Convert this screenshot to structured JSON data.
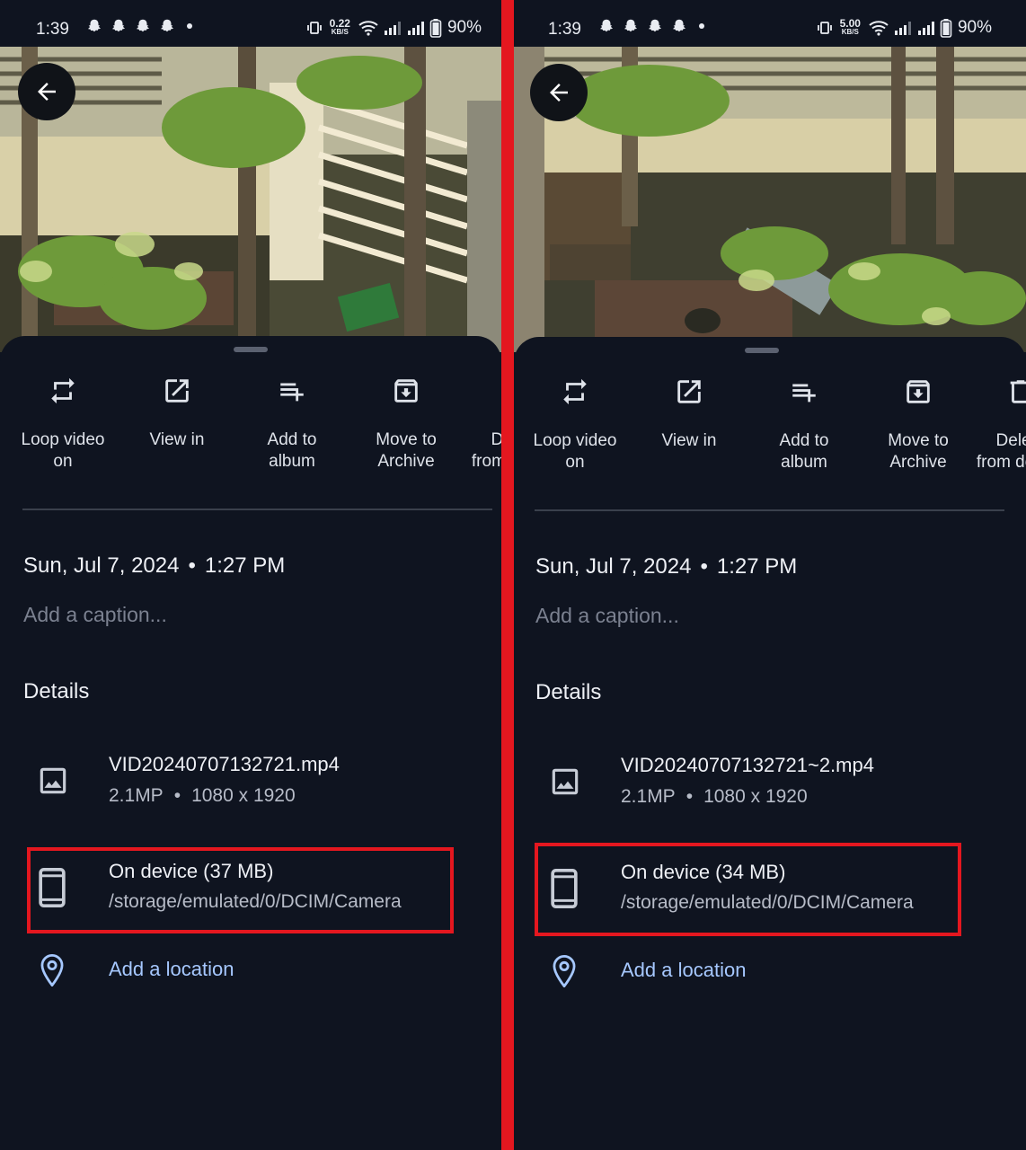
{
  "panels": [
    {
      "status": {
        "time": "1:39",
        "speed_value": "0.22",
        "speed_unit": "KB/S",
        "battery": "90%"
      },
      "actions": [
        {
          "label": "Loop video\non",
          "icon": "loop-icon"
        },
        {
          "label": "View in",
          "icon": "open-external-icon"
        },
        {
          "label": "Add to\nalbum",
          "icon": "playlist-add-icon"
        },
        {
          "label": "Move to\nArchive",
          "icon": "archive-icon"
        },
        {
          "label": "Delete\nfrom device",
          "icon": "delete-icon"
        }
      ],
      "date": "Sun, Jul 7, 2024",
      "time": "1:27 PM",
      "caption_placeholder": "Add a caption...",
      "details_title": "Details",
      "file": {
        "name": "VID20240707132721.mp4",
        "megapixels": "2.1MP",
        "resolution": "1080 x 1920"
      },
      "storage": {
        "title": "On device (37 MB)",
        "path": "/storage/emulated/0/DCIM/Camera"
      },
      "location_link": "Add a location"
    },
    {
      "status": {
        "time": "1:39",
        "speed_value": "5.00",
        "speed_unit": "KB/S",
        "battery": "90%"
      },
      "actions": [
        {
          "label": "Loop video\non",
          "icon": "loop-icon"
        },
        {
          "label": "View in",
          "icon": "open-external-icon"
        },
        {
          "label": "Add to\nalbum",
          "icon": "playlist-add-icon"
        },
        {
          "label": "Move to\nArchive",
          "icon": "archive-icon"
        },
        {
          "label": "Delete\nfrom device",
          "icon": "delete-icon"
        }
      ],
      "date": "Sun, Jul 7, 2024",
      "time": "1:27 PM",
      "caption_placeholder": "Add a caption...",
      "details_title": "Details",
      "file": {
        "name": "VID20240707132721~2.mp4",
        "megapixels": "2.1MP",
        "resolution": "1080 x 1920"
      },
      "storage": {
        "title": "On device (34 MB)",
        "path": "/storage/emulated/0/DCIM/Camera"
      },
      "location_link": "Add a location"
    }
  ],
  "colors": {
    "background": "#0f1420",
    "divider": "#e4171f",
    "highlight": "#e4171f",
    "link": "#a6c8ff"
  }
}
